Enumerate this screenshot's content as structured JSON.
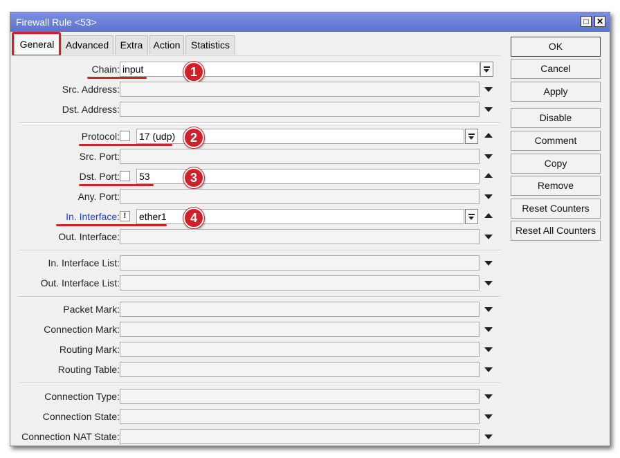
{
  "window": {
    "title": "Firewall Rule <53>",
    "maximize_glyph": "□",
    "close_glyph": "✕"
  },
  "tabs": [
    {
      "label": "General",
      "active": true
    },
    {
      "label": "Advanced"
    },
    {
      "label": "Extra"
    },
    {
      "label": "Action"
    },
    {
      "label": "Statistics"
    }
  ],
  "fields": {
    "chain": {
      "label": "Chain:",
      "value": "input"
    },
    "src_address": {
      "label": "Src. Address:",
      "value": ""
    },
    "dst_address": {
      "label": "Dst. Address:",
      "value": ""
    },
    "protocol": {
      "label": "Protocol:",
      "value": "17 (udp)"
    },
    "src_port": {
      "label": "Src. Port:",
      "value": ""
    },
    "dst_port": {
      "label": "Dst. Port:",
      "value": "53"
    },
    "any_port": {
      "label": "Any. Port:",
      "value": ""
    },
    "in_interface": {
      "label": "In. Interface:",
      "value": "ether1",
      "icon_glyph": "!"
    },
    "out_interface": {
      "label": "Out. Interface:",
      "value": ""
    },
    "in_interface_list": {
      "label": "In. Interface List:",
      "value": ""
    },
    "out_interface_list": {
      "label": "Out. Interface List:",
      "value": ""
    },
    "packet_mark": {
      "label": "Packet Mark:",
      "value": ""
    },
    "connection_mark": {
      "label": "Connection Mark:",
      "value": ""
    },
    "routing_mark": {
      "label": "Routing Mark:",
      "value": ""
    },
    "routing_table": {
      "label": "Routing Table:",
      "value": ""
    },
    "connection_type": {
      "label": "Connection Type:",
      "value": ""
    },
    "connection_state": {
      "label": "Connection State:",
      "value": ""
    },
    "connection_nat_state": {
      "label": "Connection NAT State:",
      "value": ""
    }
  },
  "annotations": {
    "badge1": "1",
    "badge2": "2",
    "badge3": "3",
    "badge4": "4",
    "color": "#d0202a"
  },
  "buttons": {
    "ok": "OK",
    "cancel": "Cancel",
    "apply": "Apply",
    "disable": "Disable",
    "comment": "Comment",
    "copy": "Copy",
    "remove": "Remove",
    "reset_counters": "Reset Counters",
    "reset_all_counters": "Reset All Counters"
  },
  "colors": {
    "titlebar": "#6a7fd8",
    "highlight": "#d0202a",
    "link_label": "#1f3fc4"
  }
}
